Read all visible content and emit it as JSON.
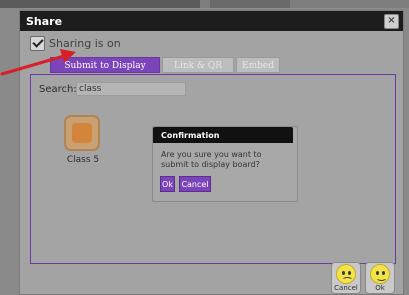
{
  "dialog": {
    "title": "Share",
    "close_label": "×"
  },
  "sharing": {
    "label": "Sharing is on",
    "checked": true
  },
  "tabs": [
    {
      "label": "Submit to Display Board",
      "active": true
    },
    {
      "label": "Link & QR code",
      "active": false
    },
    {
      "label": "Embed",
      "active": false
    }
  ],
  "search": {
    "label": "Search:",
    "value": "class"
  },
  "classes": [
    {
      "label": "Class 5",
      "icon": "class-tile-icon"
    }
  ],
  "confirmation": {
    "title": "Confirmation",
    "message": "Are you sure you want to submit to display board?",
    "ok_label": "Ok",
    "cancel_label": "Cancel"
  },
  "footer": {
    "cancel_label": "Cancel",
    "ok_label": "Ok",
    "cancel_icon": "sad-face-icon",
    "ok_icon": "happy-face-icon"
  },
  "colors": {
    "accent": "#7b44b8",
    "titlebar": "#1d1d1d",
    "annotation_arrow": "#d81f2a"
  }
}
